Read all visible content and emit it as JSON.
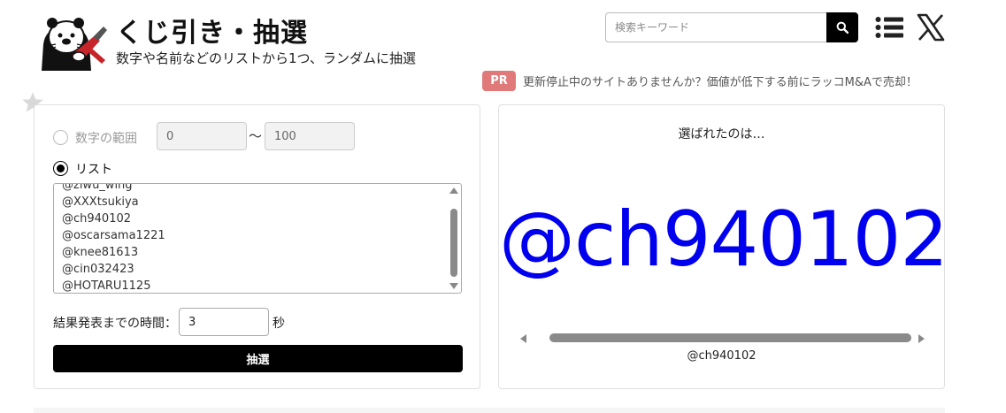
{
  "header": {
    "title": "くじ引き・抽選",
    "subtitle": "数字や名前などのリストから1つ、ランダムに抽選",
    "logo_icon": "otter-mascot-logo"
  },
  "search": {
    "placeholder": "検索キーワード",
    "value": "",
    "button_icon": "search-icon"
  },
  "nav": {
    "menu_icon": "list-menu-icon",
    "x_icon": "x-logo-icon"
  },
  "promo": {
    "badge": "PR",
    "text": "更新停止中のサイトありませんか？価値が低下する前にラッコM&Aで売却！"
  },
  "favorite_icon": "star-icon",
  "form": {
    "mode_range_label": "数字の範囲",
    "mode_list_label": "リスト",
    "selected_mode": "list",
    "range_from": "0",
    "range_to": "100",
    "range_separator": "〜",
    "list_lines": [
      "@ziwu_wing",
      "@XXXtsukiya",
      "@ch940102",
      "@oscarsama1221",
      "@knee81613",
      "@cin032423",
      "@HOTARU1125"
    ],
    "time_label": "結果発表までの時間：",
    "time_value": "3",
    "time_unit": "秒",
    "draw_button": "抽選"
  },
  "result": {
    "label": "選ばれたのは…",
    "big_value": "@ch940102",
    "small_value": "@ch940102"
  },
  "colors": {
    "accent": "#000000",
    "result_text": "#0000ee",
    "pr_badge": "#e07a7a"
  }
}
